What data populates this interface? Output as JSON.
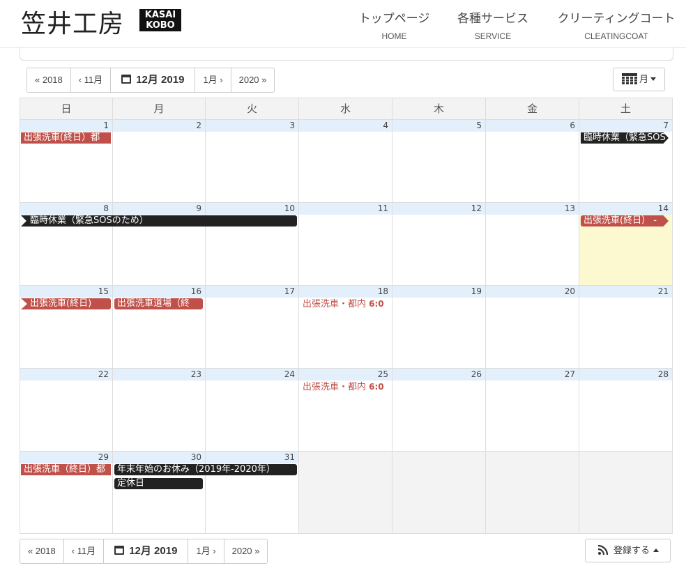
{
  "header": {
    "logo_kanji": "笠井工房",
    "logo_badge_line1": "KASAI",
    "logo_badge_line2": "KOBO",
    "nav": [
      {
        "jp": "トップページ",
        "en": "HOME"
      },
      {
        "jp": "各種サービス",
        "en": "SERVICE"
      },
      {
        "jp": "クリーティングコート",
        "en": "CLEATINGCOAT"
      }
    ]
  },
  "toolbar": {
    "prev_year": "« 2018",
    "prev_month": "‹ 11月",
    "current": "12月 2019",
    "next_month": "1月 ›",
    "next_year": "2020 »",
    "view_label": "月",
    "subscribe_label": "登録する"
  },
  "icons": {
    "calendar": "calendar-icon",
    "grid": "calendar-grid-icon",
    "rss": "rss-icon",
    "caret_down": "caret-down-icon",
    "caret_up": "caret-up-icon"
  },
  "colors": {
    "event_red": "#c0514a",
    "event_dark": "#222222",
    "day_number_bg": "#e3f0fc",
    "today_bg": "#fcf8cf",
    "other_month_bg": "#f3f3f3"
  },
  "calendar": {
    "weekdays": [
      "日",
      "月",
      "火",
      "水",
      "木",
      "金",
      "土"
    ],
    "weeks": [
      [
        "1",
        "2",
        "3",
        "4",
        "5",
        "6",
        "7"
      ],
      [
        "8",
        "9",
        "10",
        "11",
        "12",
        "13",
        "14"
      ],
      [
        "15",
        "16",
        "17",
        "18",
        "19",
        "20",
        "21"
      ],
      [
        "22",
        "23",
        "24",
        "25",
        "26",
        "27",
        "28"
      ],
      [
        "29",
        "30",
        "31",
        "",
        "",
        "",
        ""
      ]
    ],
    "today": "14",
    "events": {
      "w1_sun": "出張洗車(終日）都",
      "w1_sat": "臨時休業（緊急SOS",
      "w2_span": "臨時休業（緊急SOSのため）",
      "w2_sat": "出張洗車(終日） -",
      "w3_sun": "出張洗車(終日)",
      "w3_mon": "出張洗車道場（終",
      "w3_wed_title": "出張洗車・都内",
      "w3_wed_time": "6:0",
      "w4_wed_title": "出張洗車・都内",
      "w4_wed_time": "6:0",
      "w5_sun": "出張洗車（終日）都",
      "w5_span": "年末年始のお休み（2019年-2020年）",
      "w5_mon2": "定休日"
    }
  }
}
